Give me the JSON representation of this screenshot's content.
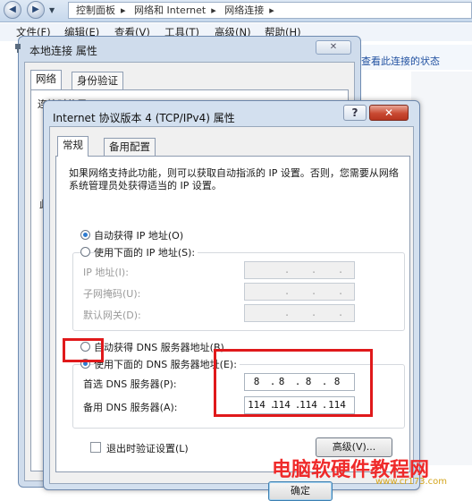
{
  "breadcrumb": [
    "控制面板",
    "网络和 Internet",
    "网络连接"
  ],
  "menu": [
    "文件(F)",
    "编辑(E)",
    "查看(V)",
    "工具(T)",
    "高级(N)",
    "帮助(H)"
  ],
  "background_link": "查看此连接的状态",
  "lan_dialog": {
    "title": "本地连接 属性",
    "tabs": [
      "网络",
      "身份验证"
    ],
    "connect_using": "连接时使用:",
    "stub_label": "此"
  },
  "ipv4_dialog": {
    "title": "Internet 协议版本 4 (TCP/IPv4) 属性",
    "help_btn": "?",
    "close_btn": "✕",
    "tabs": [
      "常规",
      "备用配置"
    ],
    "intro": "如果网络支持此功能，则可以获取自动指派的 IP 设置。否则，您需要从网络系统管理员处获得适当的 IP 设置。",
    "auto_ip": "自动获得 IP 地址(O)",
    "manual_ip": "使用下面的 IP 地址(S):",
    "ip_address_label": "IP 地址(I):",
    "subnet_label": "子网掩码(U):",
    "gateway_label": "默认网关(D):",
    "auto_dns": "自动获得 DNS 服务器地址(B)",
    "manual_dns": "使用下面的 DNS 服务器地址(E):",
    "preferred_dns_label": "首选 DNS 服务器(P):",
    "alternate_dns_label": "备用 DNS 服务器(A):",
    "preferred_dns": [
      "8",
      "8",
      "8",
      "8"
    ],
    "alternate_dns": [
      "114",
      "114",
      "114",
      "114"
    ],
    "validate_on_exit": "退出时验证设置(L)",
    "advanced_btn": "高级(V)...",
    "ok_btn": "确定",
    "ip_address_selected": "auto",
    "dns_selected": "manual"
  },
  "watermark": "电脑软硬件教程网",
  "watermark_sub": "www.cr173.com",
  "colors": {
    "highlight_red": "#e0191b",
    "radio_selected": "#2e7bd0",
    "watermark": "#ef2a2a"
  }
}
